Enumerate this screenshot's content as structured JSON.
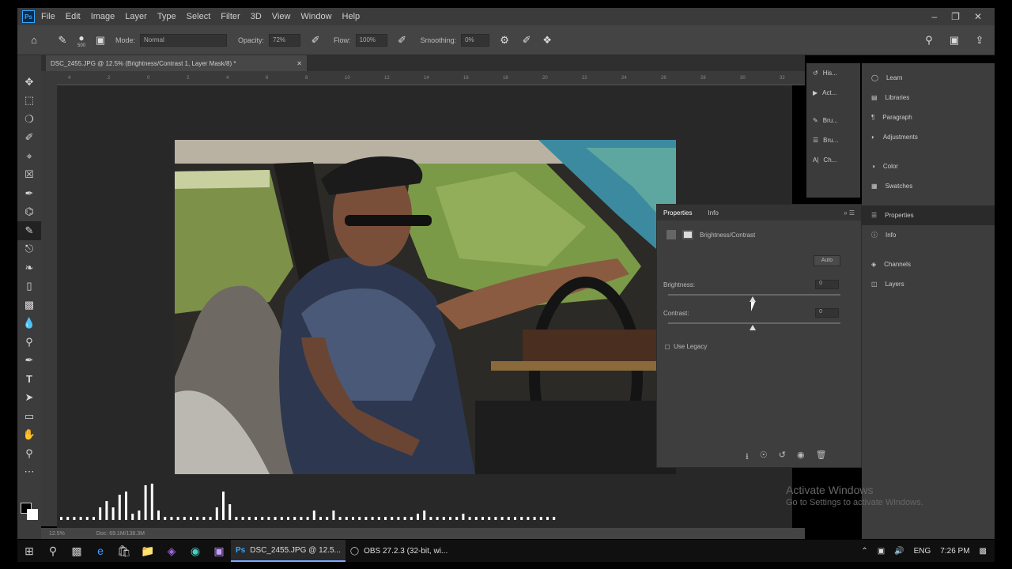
{
  "app": {
    "logo": "Ps"
  },
  "menu": [
    "File",
    "Edit",
    "Image",
    "Layer",
    "Type",
    "Select",
    "Filter",
    "3D",
    "View",
    "Window",
    "Help"
  ],
  "options": {
    "brush_size": "500",
    "mode_label": "Mode:",
    "mode_value": "Normal",
    "opacity_label": "Opacity:",
    "opacity_value": "72%",
    "flow_label": "Flow:",
    "flow_value": "100%",
    "smoothing_label": "Smoothing:",
    "smoothing_value": "0%"
  },
  "document": {
    "tab_title": "DSC_2455.JPG @ 12.5% (Brightness/Contrast 1, Layer Mask/8) *",
    "zoom": "12.5%",
    "doc_info": "Doc: 69.1M/138.3M",
    "ruler_ticks": [
      "4",
      "2",
      "0",
      "2",
      "4",
      "6",
      "8",
      "10",
      "12",
      "14",
      "16",
      "18",
      "20",
      "22",
      "24",
      "26",
      "28",
      "30",
      "32"
    ]
  },
  "dock_left": [
    {
      "icon": "history-icon",
      "label": "His..."
    },
    {
      "icon": "actions-icon",
      "label": "Act..."
    },
    {
      "icon": "brush-settings-icon",
      "label": "Bru..."
    },
    {
      "icon": "brushes-icon",
      "label": "Bru..."
    },
    {
      "icon": "character-icon",
      "label": "Ch..."
    }
  ],
  "dock_right": [
    {
      "icon": "learn-icon",
      "label": "Learn"
    },
    {
      "icon": "libraries-icon",
      "label": "Libraries"
    },
    {
      "icon": "paragraph-icon",
      "label": "Paragraph"
    },
    {
      "icon": "adjustments-icon",
      "label": "Adjustments"
    },
    {
      "icon": "color-icon",
      "label": "Color"
    },
    {
      "icon": "swatches-icon",
      "label": "Swatches"
    },
    {
      "icon": "properties-icon",
      "label": "Properties"
    },
    {
      "icon": "info-icon",
      "label": "Info"
    },
    {
      "icon": "channels-icon",
      "label": "Channels"
    },
    {
      "icon": "layers-icon",
      "label": "Layers"
    }
  ],
  "properties": {
    "tab_active": "Properties",
    "tab_other": "Info",
    "adjustment_name": "Brightness/Contrast",
    "auto_label": "Auto",
    "brightness_label": "Brightness:",
    "brightness_value": "0",
    "contrast_label": "Contrast:",
    "contrast_value": "0",
    "use_legacy_label": "Use Legacy"
  },
  "taskbar": {
    "ps_app": "DSC_2455.JPG @ 12.5...",
    "obs_app": "OBS 27.2.3 (32-bit, wi...",
    "lang": "ENG",
    "time": "7:26 PM"
  },
  "watermark": {
    "title": "Activate Windows",
    "subtitle": "Go to Settings to activate Windows."
  },
  "colors": {
    "accent": "#31a8ff",
    "panel": "#3e3e3e",
    "canvas": "#282828"
  }
}
